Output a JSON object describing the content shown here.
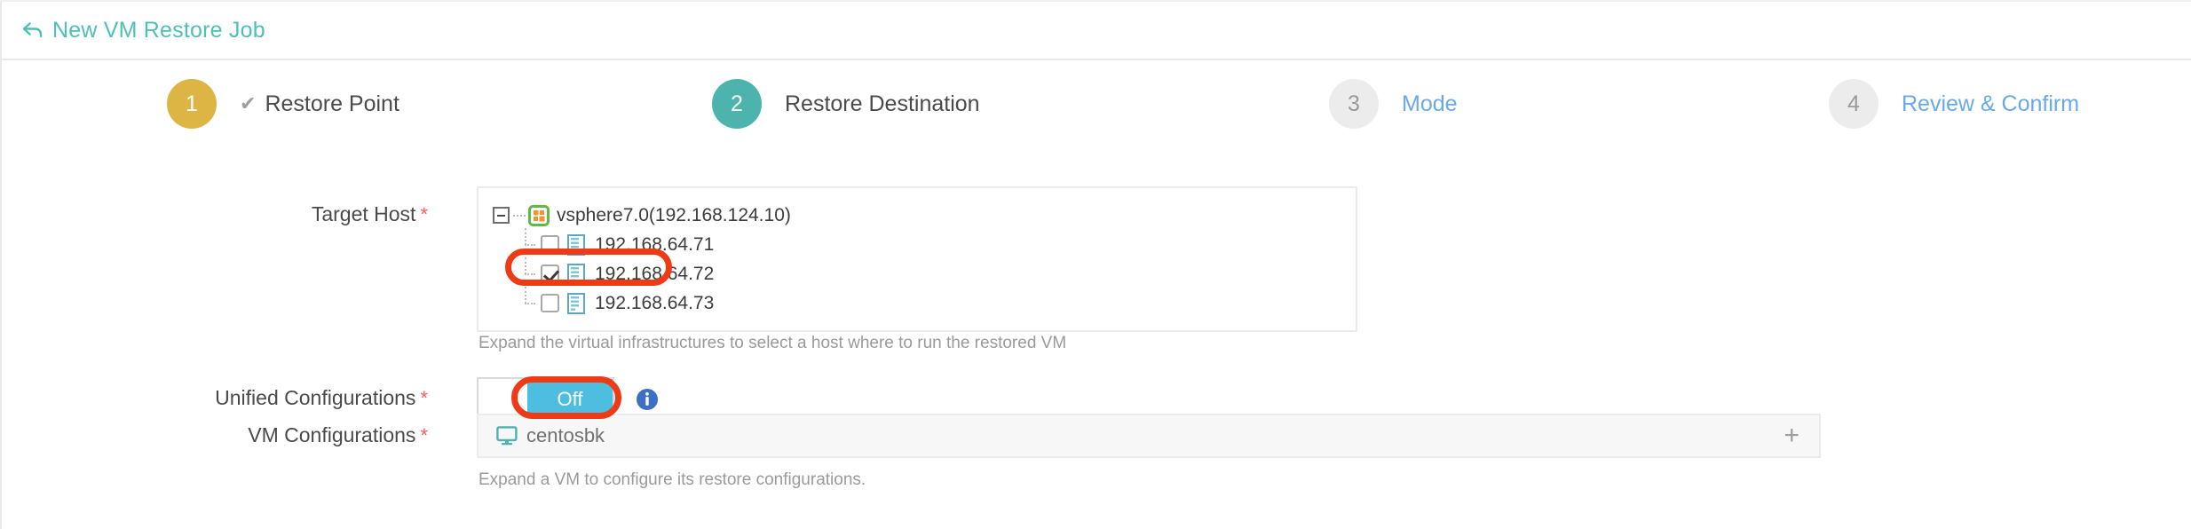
{
  "header": {
    "back_icon": "back-arrow-icon",
    "title": "New VM Restore Job",
    "accent_color": "#4ec0b4"
  },
  "steps": [
    {
      "number": "1",
      "label": "Restore Point",
      "state": "completed",
      "circle_color": "#ddb544",
      "check": "✔"
    },
    {
      "number": "2",
      "label": "Restore Destination",
      "state": "active",
      "circle_color": "#4cb4ac"
    },
    {
      "number": "3",
      "label": "Mode",
      "state": "pending",
      "circle_color": "#ececec"
    },
    {
      "number": "4",
      "label": "Review & Confirm",
      "state": "pending",
      "circle_color": "#ececec"
    }
  ],
  "form": {
    "target_host": {
      "label": "Target Host",
      "required_mark": "*",
      "tree": {
        "root": {
          "name": "vsphere7.0(192.168.124.10)",
          "expanded": true,
          "icon": "vsphere-icon"
        },
        "children": [
          {
            "name": "192.168.64.71",
            "checked": false,
            "icon": "host-icon"
          },
          {
            "name": "192.168.64.72",
            "checked": true,
            "icon": "host-icon"
          },
          {
            "name": "192.168.64.73",
            "checked": false,
            "icon": "host-icon"
          }
        ]
      },
      "hint": "Expand the virtual infrastructures to select a host where to run the restored VM"
    },
    "unified_configurations": {
      "label": "Unified Configurations",
      "required_mark": "*",
      "toggle_value": "Off",
      "toggle_color": "#4dbde0",
      "info_icon": "info-icon"
    },
    "vm_configurations": {
      "label": "VM Configurations",
      "required_mark": "*",
      "vm_name": "centosbk",
      "vm_icon": "monitor-icon",
      "expand_icon": "+",
      "hint": "Expand a VM to configure its restore configurations."
    }
  },
  "annotations": {
    "highlight_color": "#ee3b16",
    "items": [
      "selected-host-row",
      "unified-configurations-toggle"
    ]
  }
}
